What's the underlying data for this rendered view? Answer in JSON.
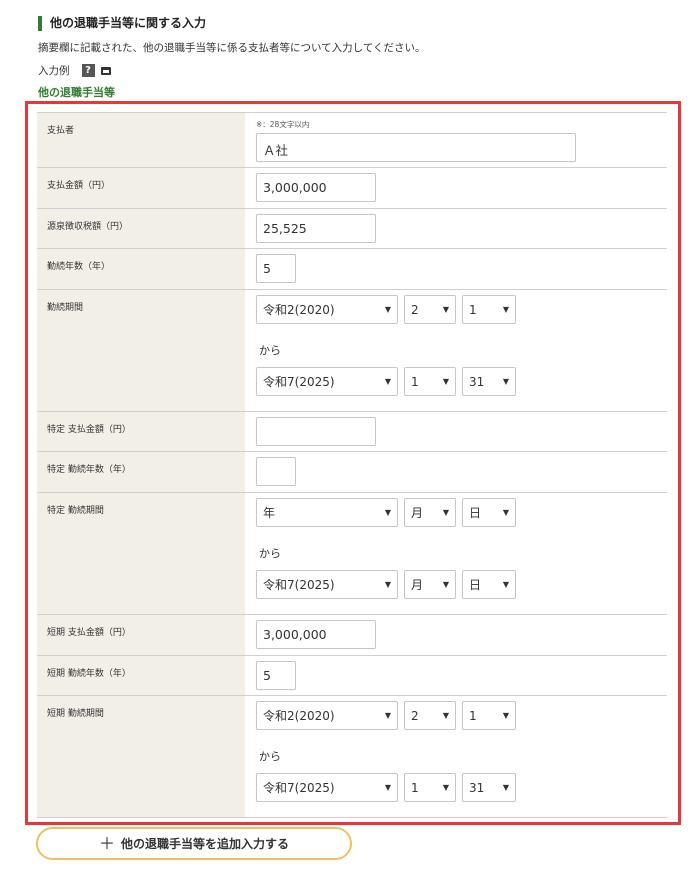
{
  "header": {
    "title": "他の退職手当等に関する入力",
    "description": "摘要欄に記載された、他の退職手当等に係る支払者等について入力してください。",
    "example_label": "入力例",
    "help_icon": "?",
    "subsection": "他の退職手当等"
  },
  "form": {
    "payer": {
      "label": "支払者",
      "note": "※：28文字以内",
      "value": "Ａ社"
    },
    "payment_amount": {
      "label": "支払金額（円）",
      "value": "3,000,000"
    },
    "withholding_tax": {
      "label": "源泉徴収税額（円）",
      "value": "25,525"
    },
    "service_years": {
      "label": "勤続年数（年）",
      "value": "5"
    },
    "service_period": {
      "label": "勤続期間",
      "from_era": "令和2(2020)",
      "from_month": "2",
      "from_day": "1",
      "kara": "から",
      "to_era": "令和7(2025)",
      "to_month": "1",
      "to_day": "31"
    },
    "specific_amount": {
      "label": "特定 支払金額（円）",
      "value": ""
    },
    "specific_years": {
      "label": "特定 勤続年数（年）",
      "value": ""
    },
    "specific_period": {
      "label": "特定 勤続期間",
      "from_era": "年",
      "from_month": "月",
      "from_day": "日",
      "kara": "から",
      "to_era": "令和7(2025)",
      "to_month": "月",
      "to_day": "日"
    },
    "short_amount": {
      "label": "短期 支払金額（円）",
      "value": "3,000,000"
    },
    "short_years": {
      "label": "短期 勤続年数（年）",
      "value": "5"
    },
    "short_period": {
      "label": "短期 勤続期間",
      "from_era": "令和2(2020)",
      "from_month": "2",
      "from_day": "1",
      "kara": "から",
      "to_era": "令和7(2025)",
      "to_month": "1",
      "to_day": "31"
    }
  },
  "add_button": {
    "label": "他の退職手当等を追加入力する",
    "icon": "plus-icon"
  },
  "colors": {
    "accent_green": "#2e7d32",
    "highlight_red": "#e53935",
    "label_bg": "#f2efe6",
    "button_border": "#f0c060"
  }
}
